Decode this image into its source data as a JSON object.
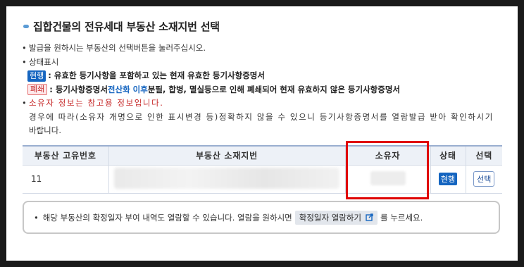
{
  "title": "집합건물의 전유세대 부동산 소재지번 선택",
  "bullets": {
    "b1": "발급을 원하시는 부동산의 선택버튼을 눌러주십시오.",
    "b2": "상태표시",
    "b3_badge": "현행",
    "b3_text": ": 유효한 등기사항을 포함하고 있는 현재 유효한 등기사항증명서",
    "b4_badge": "폐쇄",
    "b4_text_a": ": 등기사항증명서 ",
    "b4_text_blue": "전산화 이후",
    "b4_text_b": " 분필, 합병, 멸실등으로 인해 폐쇄되어 현재 유효하지 않은 등기사항증명서",
    "b5": "소유자 정보는 참고용 정보입니다.",
    "b6": "경우에 따라(소유자 개명으로 인한 표시변경 등)정확하지 않을 수 있으니 등기사항증명서를 열람발급 받아 확인하시기",
    "b7": "바랍니다."
  },
  "table": {
    "headers": [
      "부동산 고유번호",
      "부동산 소재지번",
      "소유자",
      "상태",
      "선택"
    ],
    "rows": [
      {
        "id": "11",
        "address": "",
        "owner": "",
        "status": "현행",
        "select": "선택"
      }
    ]
  },
  "notice": {
    "text_a": "해당 부동산의 확정일자 부여 내역도 열람할 수 있습니다. 열람을 원하시면",
    "button": "확정일자 열람하기",
    "text_b": "를 누르세요."
  },
  "colors": {
    "accent": "#1565c0",
    "highlight": "#e00000",
    "closed": "#c62828"
  }
}
